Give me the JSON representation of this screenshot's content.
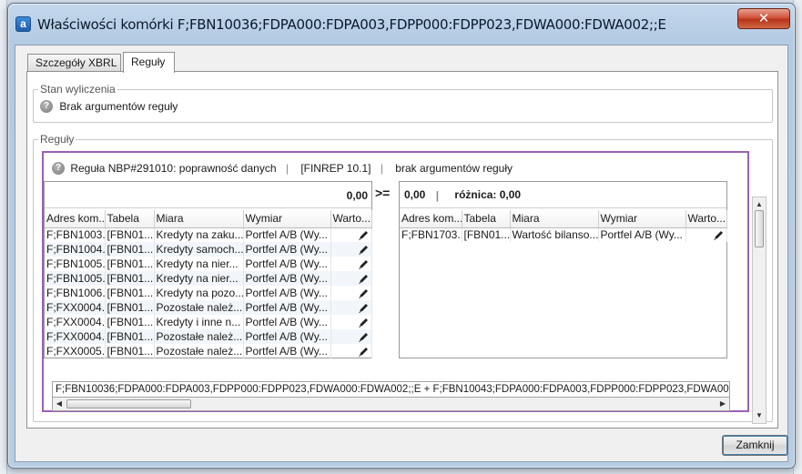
{
  "window": {
    "title": "Właściwości komórki F;FBN10036;FDPA000:FDPA003,FDPP000:FDPP023,FDWA000:FDWA002;;E",
    "app_icon_letter": "a",
    "close_glyph": "✕",
    "title_bar_color": "#b9cfe6",
    "close_button_color": "#c8452c"
  },
  "tabs": [
    {
      "label": "Szczegóły XBRL",
      "active": false
    },
    {
      "label": "Reguły",
      "active": true
    }
  ],
  "calc_status": {
    "legend": "Stan wyliczenia",
    "icon": "question-icon",
    "text": "Brak argumentów reguły"
  },
  "rules": {
    "legend": "Reguły",
    "border_color": "#9e5fb4",
    "rule_title": "Reguła NBP#291010: poprawność danych",
    "template": "[FINREP 10.1]",
    "status": "brak argumentów reguły",
    "left_sum": "0,00",
    "operator": ">=",
    "right_sum": "0,00",
    "difference_label": "różnica: 0,00",
    "columns": [
      "Adres kom...",
      "Tabela",
      "Miara",
      "Wymiar",
      "Warto..."
    ],
    "left_rows": [
      [
        "F;FBN1003...",
        "[FBN01...",
        "Kredyty na zaku...",
        "Portfel A/B (Wy..."
      ],
      [
        "F;FBN1004...",
        "[FBN01...",
        "Kredyty samoch...",
        "Portfel A/B (Wy..."
      ],
      [
        "F;FBN1005...",
        "[FBN01...",
        "Kredyty na nier...",
        "Portfel A/B (Wy..."
      ],
      [
        "F;FBN1005...",
        "[FBN01...",
        "Kredyty na nier...",
        "Portfel A/B (Wy..."
      ],
      [
        "F;FBN1006...",
        "[FBN01...",
        "Kredyty na pozo...",
        "Portfel A/B (Wy..."
      ],
      [
        "F;FXX0004...",
        "[FBN01...",
        "Pozostałe należ...",
        "Portfel A/B (Wy..."
      ],
      [
        "F;FXX0004...",
        "[FBN01...",
        "Kredyty i inne n...",
        "Portfel A/B (Wy..."
      ],
      [
        "F;FXX0004...",
        "[FBN01...",
        "Pozostałe należ...",
        "Portfel A/B (Wy..."
      ],
      [
        "F;FXX0005...",
        "[FBN01...",
        "Pozostałe należ...",
        "Portfel A/B (Wy..."
      ]
    ],
    "right_rows": [
      [
        "F;FBN1703...",
        "[FBN01...",
        "Wartość bilanso...",
        "Portfel A/B (Wy..."
      ]
    ],
    "edit_icon": "pencil-icon",
    "formula": "F;FBN10036;FDPA000:FDPA003,FDPP000:FDPP023,FDWA000:FDWA002;;E + F;FBN10043;FDPA000:FDPA003,FDPP000:FDPP023,FDWA000:FDWA0"
  },
  "footer": {
    "close_label": "Zamknij"
  }
}
